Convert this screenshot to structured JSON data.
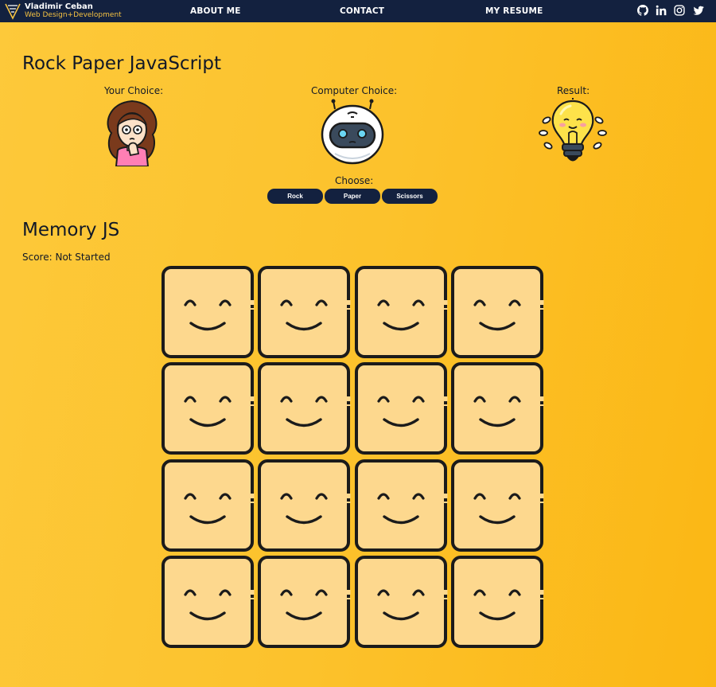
{
  "nav": {
    "brand_name": "Vladimir Ceban",
    "brand_tagline": "Web Design+Development",
    "links": [
      "ABOUT ME",
      "CONTACT",
      "MY RESUME"
    ],
    "social_icons": [
      "github-icon",
      "linkedin-icon",
      "instagram-icon",
      "twitter-icon"
    ]
  },
  "rps": {
    "title": "Rock Paper JavaScript",
    "your_choice_label": "Your Choice:",
    "computer_choice_label": "Computer Choice:",
    "result_label": "Result:",
    "choose_label": "Choose:",
    "buttons": [
      "Rock",
      "Paper",
      "Scissors"
    ]
  },
  "memory": {
    "title": "Memory JS",
    "score_text": "Score: Not Started",
    "card_count": 16
  },
  "colors": {
    "navbar": "#13213f",
    "accent": "#f5c242",
    "background": "#fcc22c",
    "card_face": "#fdd88e",
    "card_stroke": "#1b1b1b"
  }
}
